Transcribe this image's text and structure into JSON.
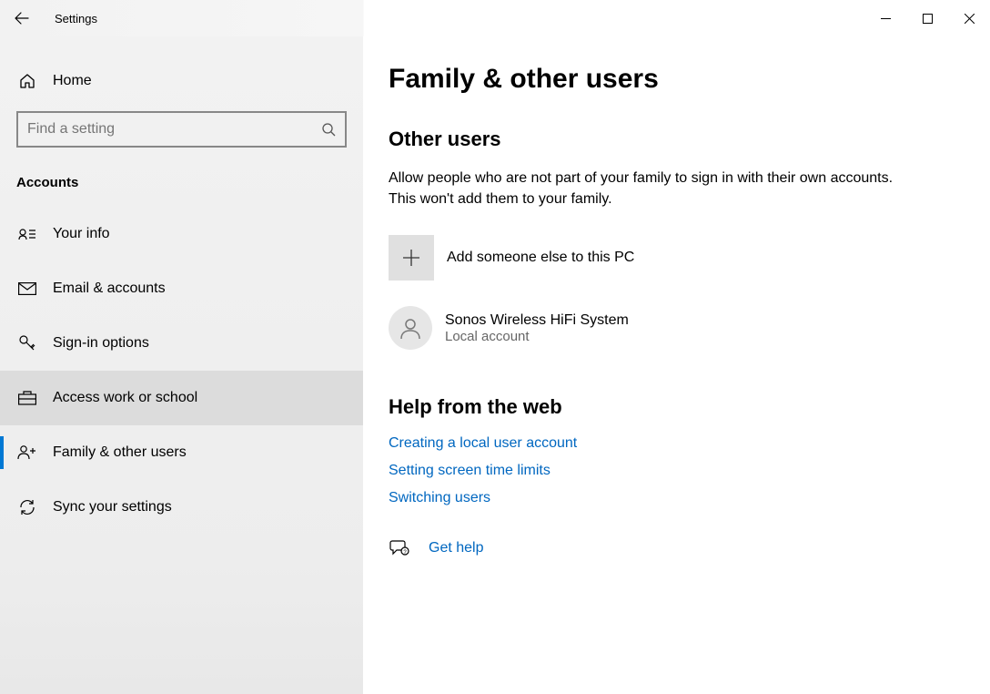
{
  "window": {
    "title": "Settings"
  },
  "sidebar": {
    "home": "Home",
    "search_placeholder": "Find a setting",
    "section_label": "Accounts",
    "items": [
      {
        "label": "Your info"
      },
      {
        "label": "Email & accounts"
      },
      {
        "label": "Sign-in options"
      },
      {
        "label": "Access work or school"
      },
      {
        "label": "Family & other users"
      },
      {
        "label": "Sync your settings"
      }
    ]
  },
  "main": {
    "title": "Family & other users",
    "section_title": "Other users",
    "description": "Allow people who are not part of your family to sign in with their own accounts. This won't add them to your family.",
    "add_label": "Add someone else to this PC",
    "user": {
      "name": "Sonos Wireless HiFi System",
      "sub": "Local account"
    },
    "help_title": "Help from the web",
    "help_links": [
      "Creating a local user account",
      "Setting screen time limits",
      "Switching users"
    ],
    "get_help": "Get help"
  }
}
